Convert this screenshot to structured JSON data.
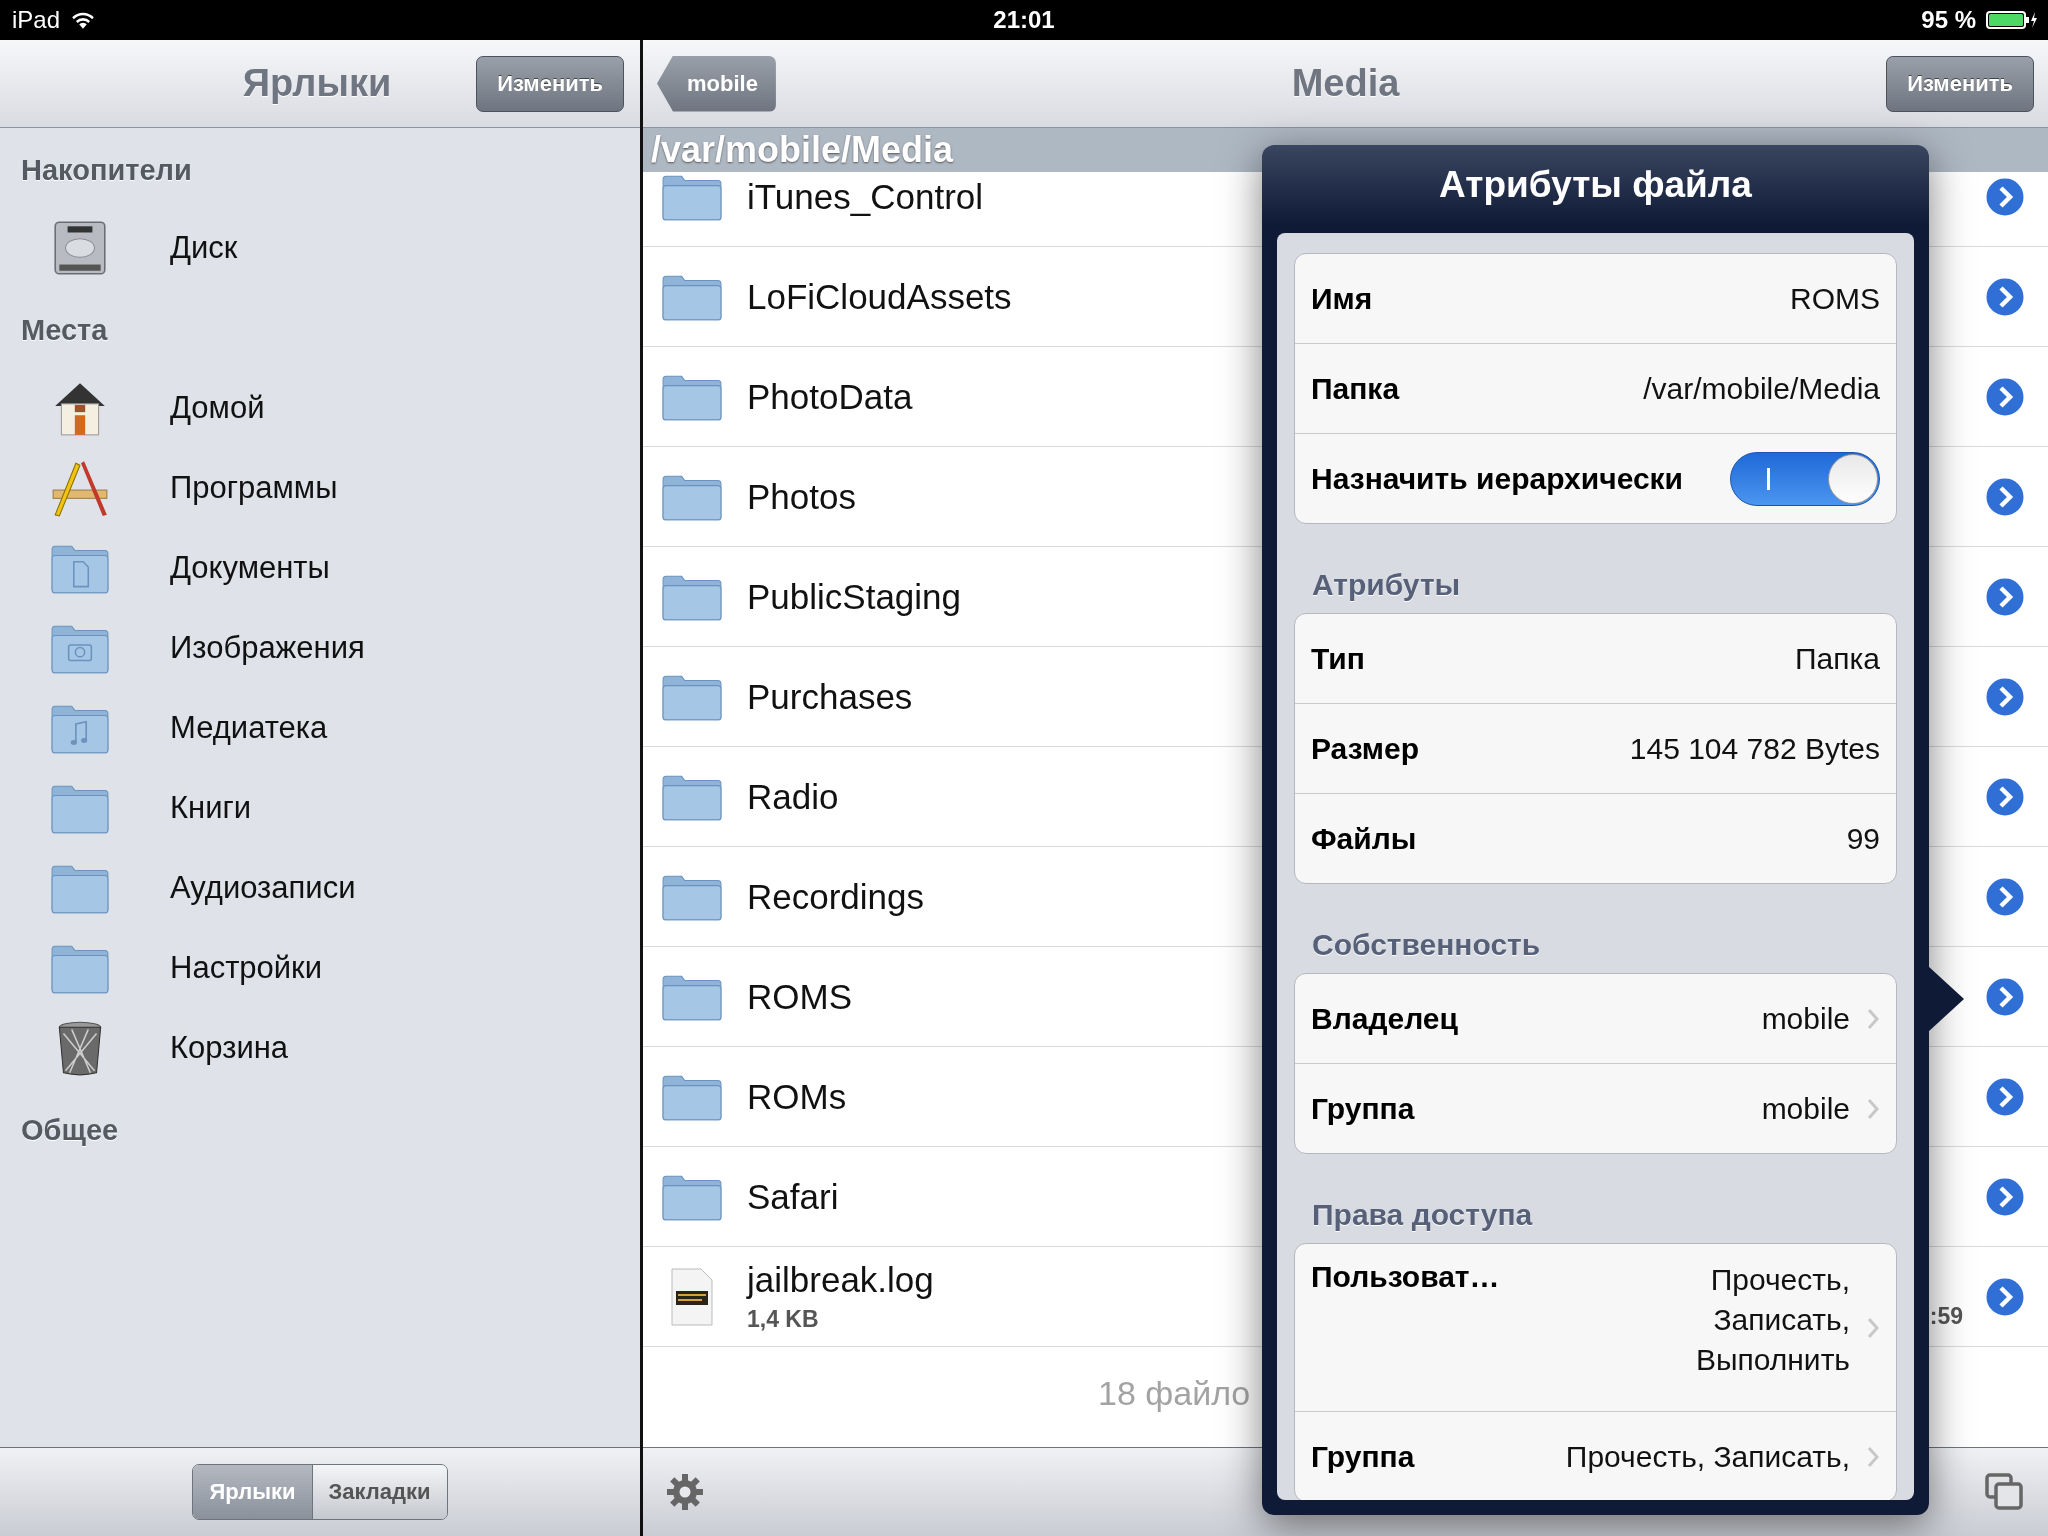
{
  "status_bar": {
    "device": "iPad",
    "time": "21:01",
    "battery": "95 %"
  },
  "sidebar": {
    "title": "Ярлыки",
    "edit_button": "Изменить",
    "sections": [
      {
        "title": "Накопители",
        "items": [
          {
            "label": "Диск",
            "kind": "disk"
          }
        ]
      },
      {
        "title": "Места",
        "items": [
          {
            "label": "Домой",
            "kind": "home"
          },
          {
            "label": "Программы",
            "kind": "apps"
          },
          {
            "label": "Документы",
            "kind": "documents"
          },
          {
            "label": "Изображения",
            "kind": "pictures"
          },
          {
            "label": "Медиатека",
            "kind": "music"
          },
          {
            "label": "Книги",
            "kind": "folder"
          },
          {
            "label": "Аудиозаписи",
            "kind": "folder"
          },
          {
            "label": "Настройки",
            "kind": "folder"
          },
          {
            "label": "Корзина",
            "kind": "trash"
          }
        ]
      },
      {
        "title": "Общее"
      }
    ],
    "segments": [
      {
        "label": "Ярлыки",
        "selected": true
      },
      {
        "label": "Закладки",
        "selected": false
      }
    ]
  },
  "browser": {
    "back_button": "mobile",
    "title": "Media",
    "edit_button": "Изменить",
    "path": "/var/mobile/Media",
    "files": [
      {
        "kind": "folder",
        "name": "iTunes_Control"
      },
      {
        "kind": "folder",
        "name": "LoFiCloudAssets"
      },
      {
        "kind": "folder",
        "name": "PhotoData"
      },
      {
        "kind": "folder",
        "name": "Photos"
      },
      {
        "kind": "folder",
        "name": "PublicStaging"
      },
      {
        "kind": "folder",
        "name": "Purchases"
      },
      {
        "kind": "folder",
        "name": "Radio"
      },
      {
        "kind": "folder",
        "name": "Recordings"
      },
      {
        "kind": "folder",
        "name": "ROMS"
      },
      {
        "kind": "folder",
        "name": "ROMs"
      },
      {
        "kind": "folder",
        "name": "Safari"
      },
      {
        "kind": "file",
        "name": "jailbreak.log",
        "size": "1,4 KB",
        "time": ":59"
      }
    ],
    "footer": "18 файло"
  },
  "popover": {
    "title": "Атрибуты файла",
    "groups": [
      {
        "rows": [
          {
            "kind": "text",
            "label": "Имя",
            "lines": [
              "ROMS"
            ],
            "chevron": false
          },
          {
            "kind": "text",
            "label": "Папка",
            "lines": [
              "/var/mobile/Media"
            ],
            "chevron": false
          },
          {
            "kind": "toggle",
            "label": "Назначить иерархически",
            "on": true
          }
        ]
      },
      {
        "header": "Атрибуты",
        "rows": [
          {
            "kind": "text",
            "label": "Тип",
            "lines": [
              "Папка"
            ],
            "chevron": false
          },
          {
            "kind": "text",
            "label": "Размер",
            "lines": [
              "145 104 782 Bytes"
            ],
            "chevron": false
          },
          {
            "kind": "text",
            "label": "Файлы",
            "lines": [
              "99"
            ],
            "chevron": false
          }
        ]
      },
      {
        "header": "Собственность",
        "rows": [
          {
            "kind": "text",
            "label": "Владелец",
            "lines": [
              "mobile"
            ],
            "chevron": true
          },
          {
            "kind": "text",
            "label": "Группа",
            "lines": [
              "mobile"
            ],
            "chevron": true
          }
        ]
      },
      {
        "header": "Права доступа",
        "rows": [
          {
            "kind": "text",
            "label": "Пользоват…",
            "lines": [
              "Прочесть,",
              "Записать,",
              "Выполнить"
            ],
            "chevron": true
          },
          {
            "kind": "text",
            "label": "Группа",
            "lines": [
              "Прочесть, Записать,"
            ],
            "chevron": true
          }
        ]
      }
    ]
  }
}
